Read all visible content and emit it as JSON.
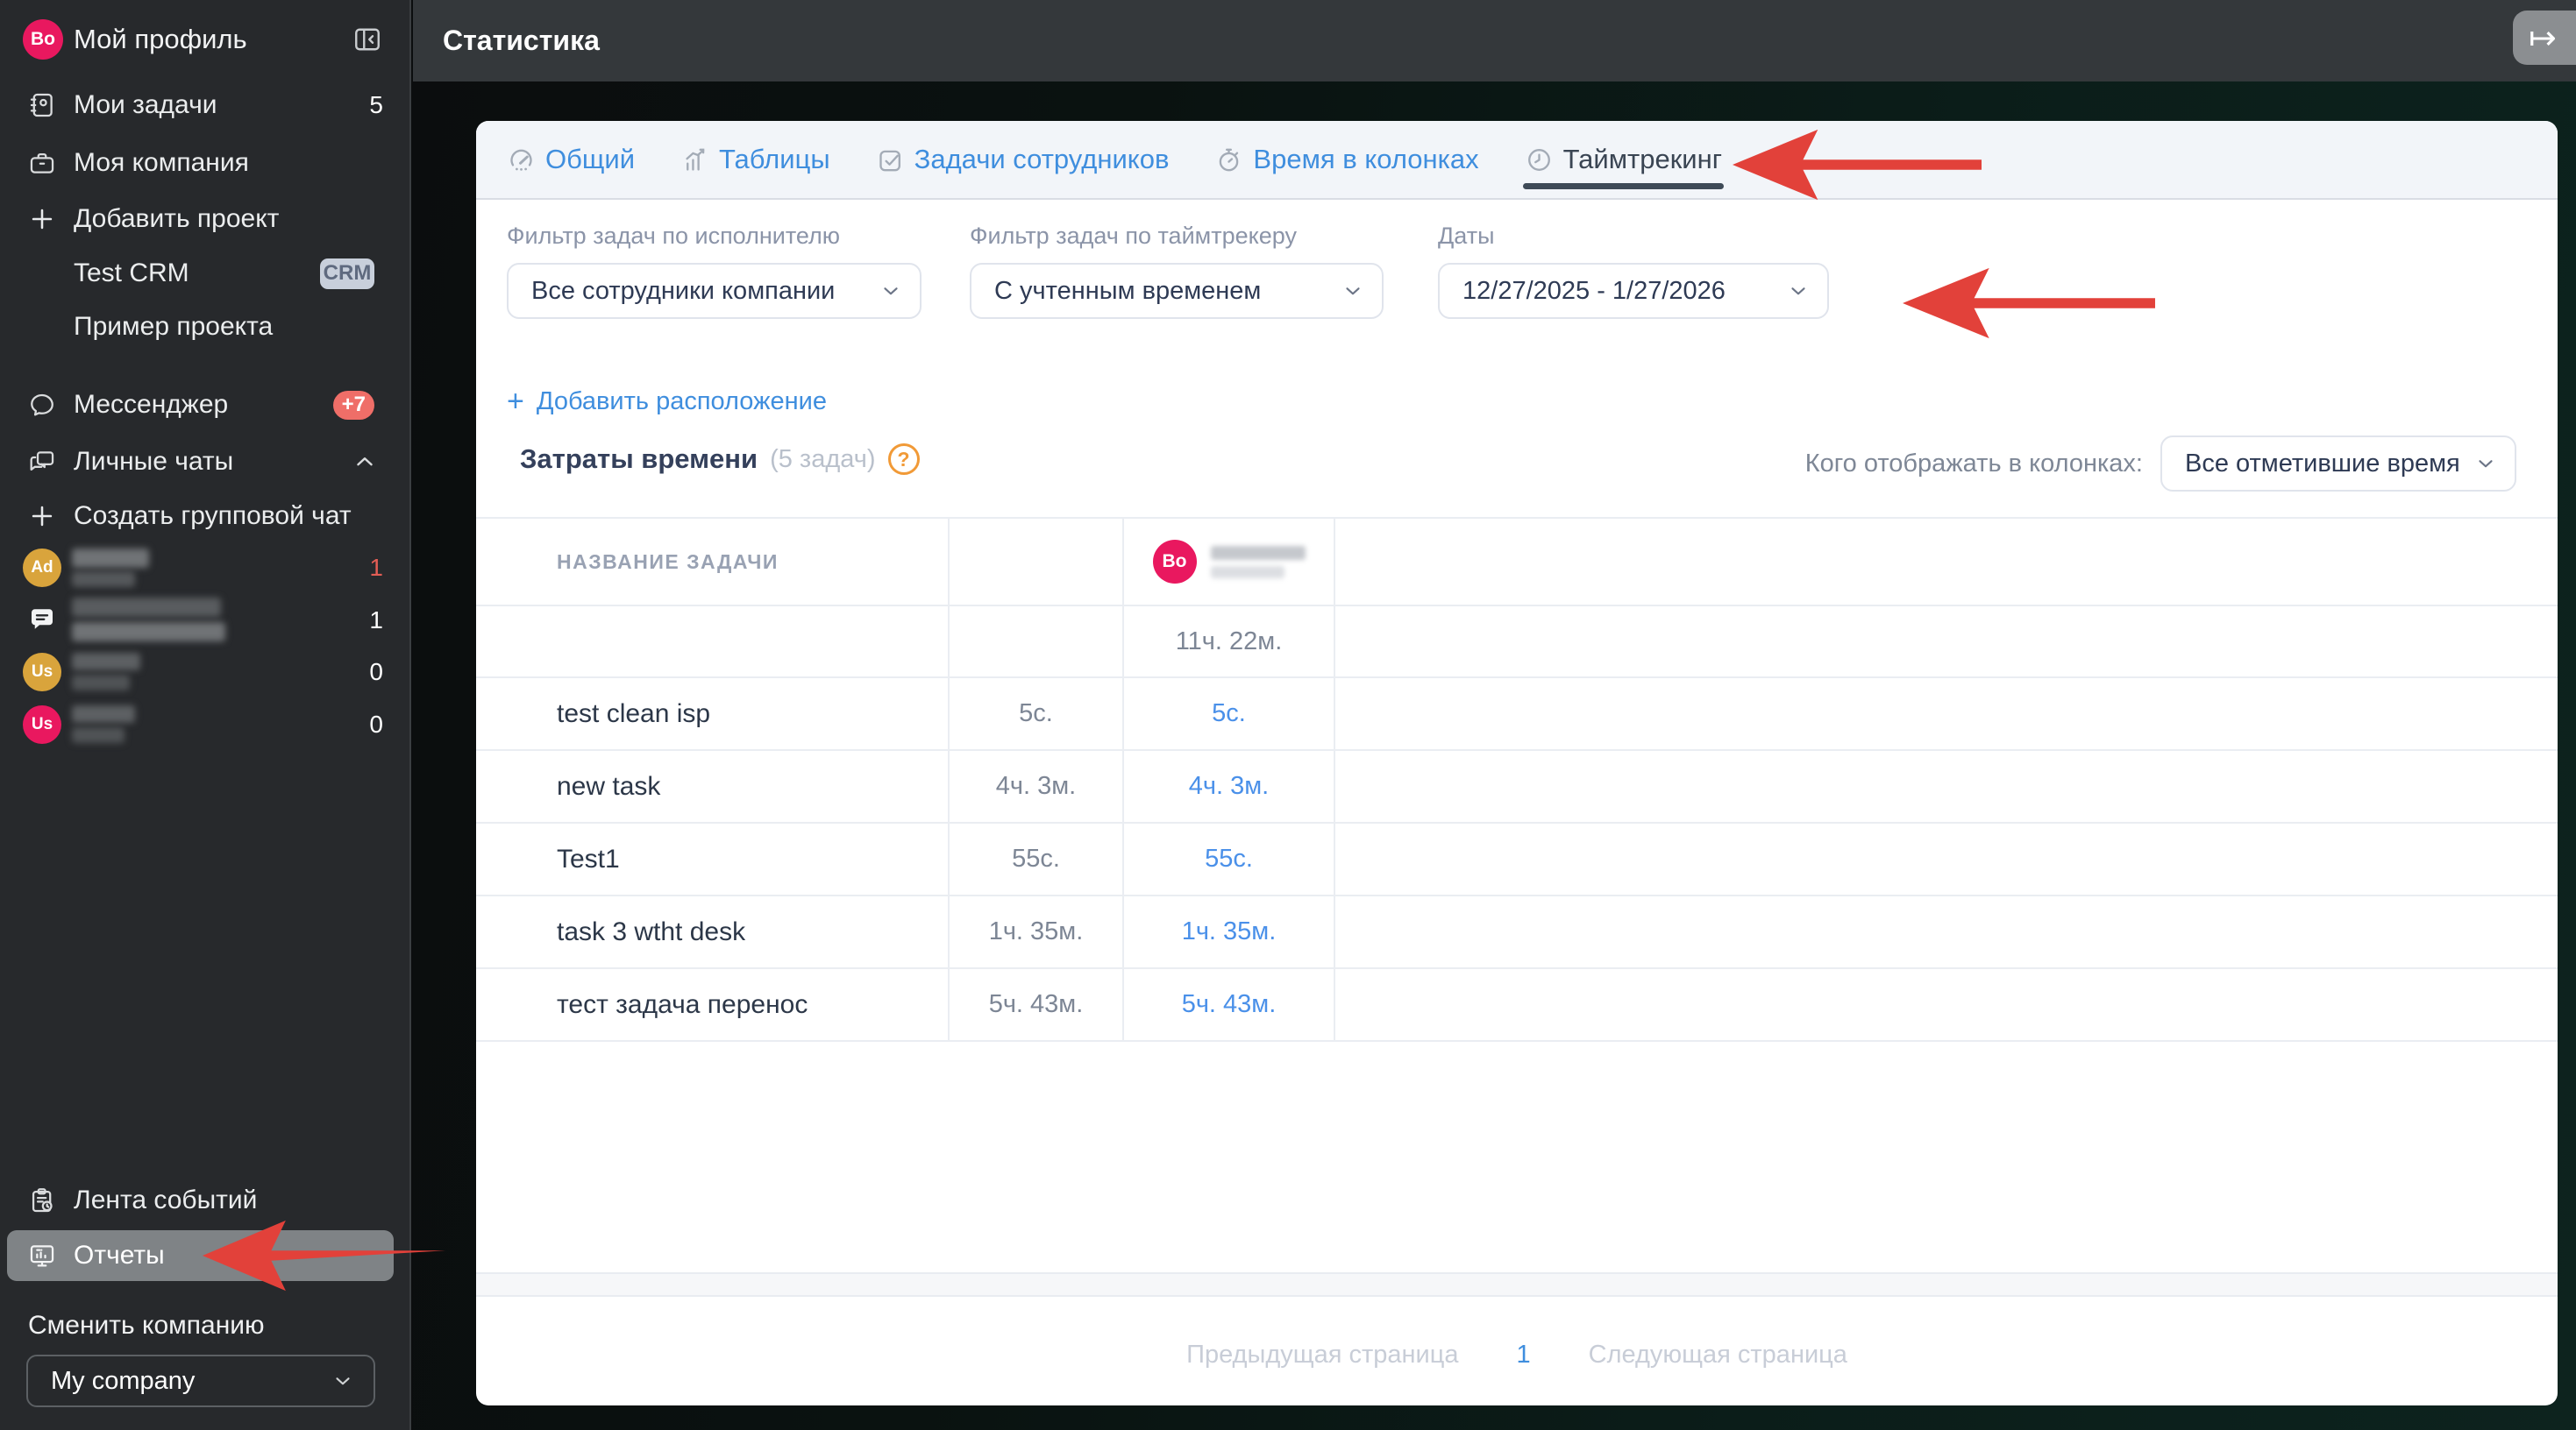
{
  "icons": {
    "plus": "+",
    "arrow_from_bar": "↦",
    "question": "?"
  },
  "header": {
    "title": "Статистика"
  },
  "sidebar": {
    "profile": {
      "label": "Мой профиль",
      "avatar": "Bo"
    },
    "my_tasks": {
      "label": "Мои задачи",
      "count": "5"
    },
    "my_company": {
      "label": "Моя компания"
    },
    "add_project": {
      "label": "Добавить проект"
    },
    "projects": [
      {
        "label": "Test CRM",
        "badge": "CRM"
      },
      {
        "label": "Пример проекта"
      }
    ],
    "messenger": {
      "label": "Мессенджер",
      "badge": "+7"
    },
    "personal_chats": {
      "label": "Личные чаты"
    },
    "create_group_chat": {
      "label": "Создать групповой чат"
    },
    "chats": [
      {
        "avatar": "Ad",
        "count": "1"
      },
      {
        "avatar": "",
        "count": "1"
      },
      {
        "avatar": "Us",
        "count": "0"
      },
      {
        "avatar": "Us",
        "count": "0"
      }
    ],
    "events_feed": {
      "label": "Лента событий"
    },
    "reports": {
      "label": "Отчеты"
    },
    "change_company": {
      "label": "Сменить компанию"
    },
    "company_select": {
      "value": "My company"
    }
  },
  "tabs": {
    "items": [
      {
        "label": "Общий"
      },
      {
        "label": "Таблицы"
      },
      {
        "label": "Задачи сотрудников"
      },
      {
        "label": "Время в колонках"
      },
      {
        "label": "Таймтрекинг"
      }
    ]
  },
  "filters": {
    "assignee": {
      "label": "Фильтр задач по исполнителю",
      "value": "Все сотрудники компании"
    },
    "timetracker": {
      "label": "Фильтр задач по таймтрекеру",
      "value": "С учтенным временем"
    },
    "dates": {
      "label": "Даты",
      "value": "12/27/2025 - 1/27/2026"
    }
  },
  "add_location": {
    "label": "Добавить расположение"
  },
  "time_section": {
    "title": "Затраты времени",
    "count": "(5 задач)"
  },
  "columns_filter": {
    "label": "Кого отображать в колонках:",
    "value": "Все отметившие время"
  },
  "time_table": {
    "name_header": "НАЗВАНИЕ ЗАДАЧИ",
    "user_avatar": "Bo",
    "user_total": "11ч. 22м.",
    "rows": [
      {
        "name": "test clean isp",
        "total": "5с.",
        "user_time": "5с."
      },
      {
        "name": "new task",
        "total": "4ч. 3м.",
        "user_time": "4ч. 3м."
      },
      {
        "name": "Test1",
        "total": "55с.",
        "user_time": "55с."
      },
      {
        "name": "task 3 wtht desk",
        "total": "1ч. 35м.",
        "user_time": "1ч. 35м."
      },
      {
        "name": "тест задача перенос",
        "total": "5ч. 43м.",
        "user_time": "5ч. 43м."
      }
    ]
  },
  "pagination": {
    "prev": "Предыдущая страница",
    "page": "1",
    "next": "Следующая страница"
  },
  "colors": {
    "accent_blue": "#3f8ede",
    "arrow_red": "#e2413a",
    "avatar_pink": "#e9185f",
    "avatar_amber": "#d9a43c",
    "badge_red": "#ef6e68",
    "online_green": "#63c141",
    "help_orange": "#f19a37"
  }
}
